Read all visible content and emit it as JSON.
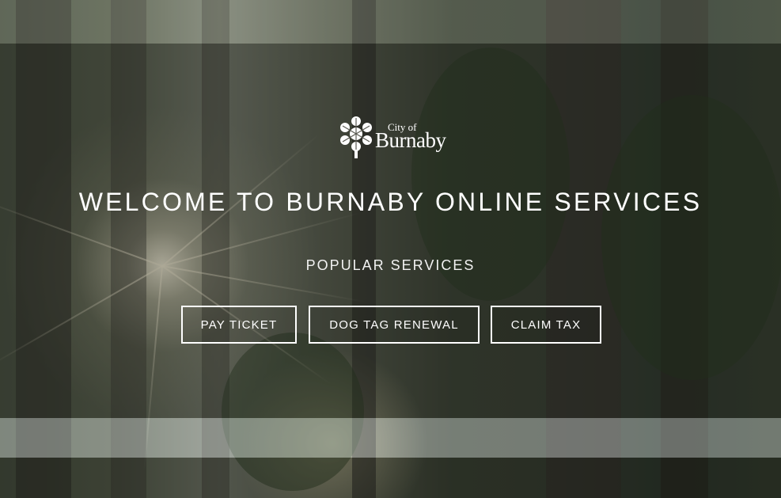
{
  "logo": {
    "city_label": "City of",
    "name_label": "Burnaby"
  },
  "header": {
    "title": "WELCOME TO BURNABY ONLINE SERVICES"
  },
  "services": {
    "heading": "POPULAR SERVICES",
    "buttons": [
      {
        "label": "PAY TICKET"
      },
      {
        "label": "DOG TAG RENEWAL"
      },
      {
        "label": "CLAIM TAX"
      }
    ]
  },
  "colors": {
    "text": "#ffffff",
    "button_border": "#ffffff"
  },
  "icons": {
    "logo": "snowflake-icon"
  }
}
